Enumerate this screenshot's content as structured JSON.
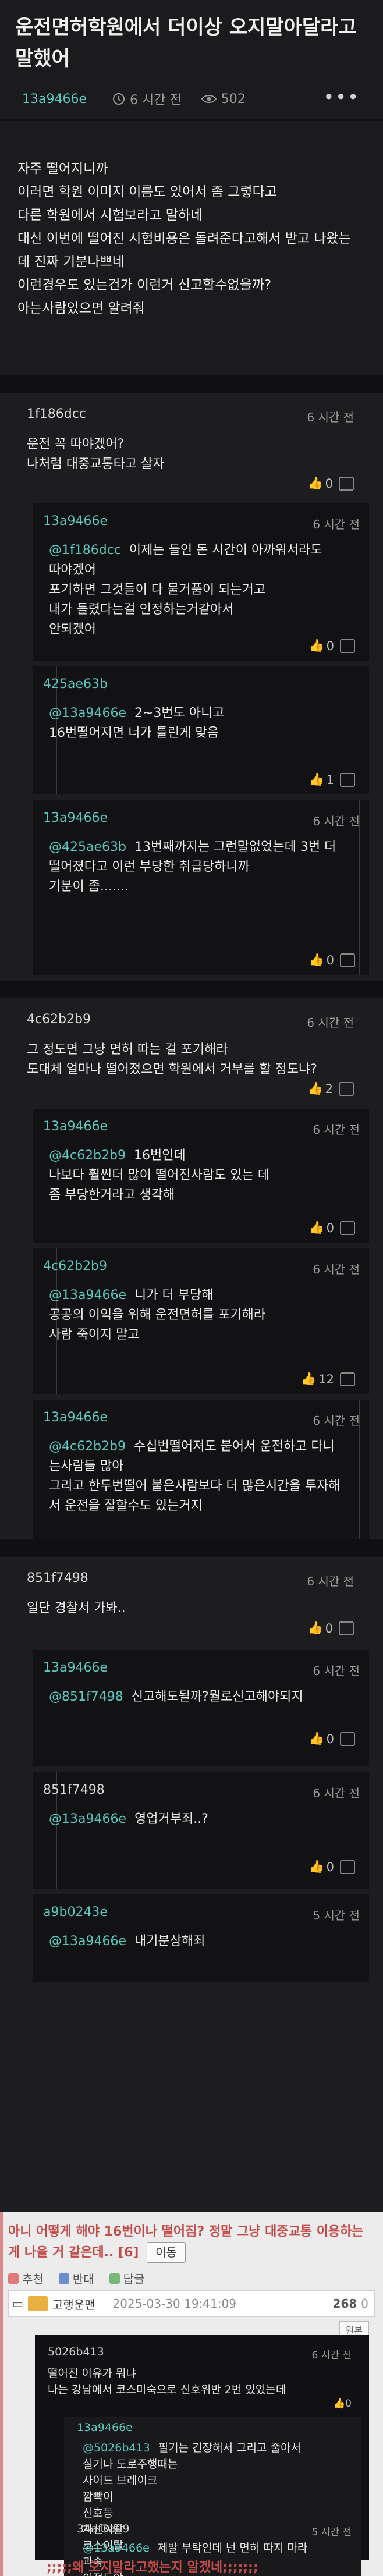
{
  "post": {
    "title": "운전면허학원에서 더이상 오지말아달라고 말했어",
    "author": "13a9466e",
    "time": "6 시간 전",
    "views": "502",
    "more": "•••",
    "body": [
      "자주 떨어지니까",
      "이러면 학원 이미지 이름도 있어서 좀 그렇다고",
      "다른 학원에서 시험보라고 말하네",
      "대신 이번에 떨어진 시험비용은 돌려준다고해서 받고 나왔는",
      "데 진짜 기분나쁘네",
      "이런경우도 있는건가 이런거 신고할수없을까?",
      "아는사람있으면 알려줘"
    ]
  },
  "threads": [
    {
      "author": "1f186dcc",
      "time": "6 시간 전",
      "lines": [
        "운전 꼭 따야겠어?",
        "나처럼 대중교통타고 살자"
      ],
      "likes": "0",
      "replies": [
        {
          "author": "13a9466e",
          "time": "6 시간 전",
          "mention": "@1f186dcc",
          "lines": [
            "이제는 들인 돈 시간이 아까워서라도",
            "따야겠어",
            "포기하면 그것들이 다 물거품이 되는거고",
            "내가 틀렸다는걸 인정하는거같아서",
            "안되겠어"
          ],
          "likes": "0"
        },
        {
          "author": "425ae63b",
          "time": "",
          "mention": "@13a9466e",
          "lines": [
            "2~3번도 아니고",
            "16번떨어지면 너가 틀린게 맞음"
          ],
          "likes": "1"
        },
        {
          "author": "13a9466e",
          "time": "6 시간 전",
          "mention": "@425ae63b",
          "lines": [
            "13번째까지는 그런말없었는데 3번 더",
            "떨어졌다고 이런 부당한 취급당하니까",
            "기분이 좀......."
          ],
          "likes": "0"
        }
      ]
    },
    {
      "author": "4c62b2b9",
      "time": "6 시간 전",
      "lines": [
        "그 정도면 그냥 면허 따는 걸 포기해라",
        "도대체 얼마나 떨어졌으면 학원에서 거부를 할 정도냐?"
      ],
      "likes": "2",
      "replies": [
        {
          "author": "13a9466e",
          "time": "6 시간 전",
          "mention": "@4c62b2b9",
          "lines": [
            "16번인데",
            "나보다 훨씬더 많이 떨어진사람도 있는 데",
            "좀 부당한거라고 생각해"
          ],
          "likes": "0"
        },
        {
          "author": "4c62b2b9",
          "time": "6 시간 전",
          "mention": "@13a9466e",
          "lines": [
            "니가 더 부당해",
            "공공의 이익을 위해 운전면허를 포기해라",
            "사람 죽이지 말고"
          ],
          "likes": "12"
        },
        {
          "author": "13a9466e",
          "time": "6 시간 전",
          "mention": "@4c62b2b9",
          "lines": [
            "수십번떨어져도 붙어서 운전하고 다니",
            "는사람들 많아",
            "그리고 한두번떨어 붙은사람보다 더 많은시간을 투자해",
            "서 운전을 잘할수도 있는거지"
          ],
          "likes": ""
        }
      ]
    },
    {
      "author": "851f7498",
      "time": "6 시간 전",
      "lines": [
        "일단 경찰서 가봐.."
      ],
      "likes": "0",
      "replies": [
        {
          "author": "13a9466e",
          "time": "6 시간 전",
          "mention": "@851f7498",
          "lines": [
            "신고해도될까?뭘로신고해야되지"
          ],
          "likes": "0"
        },
        {
          "author": "851f7498",
          "time": "6 시간 전",
          "mention": "@13a9466e",
          "lines": [
            "영업거부죄..?"
          ],
          "likes": "0"
        },
        {
          "author": "a9b0243e",
          "time": "5 시간 전",
          "mention": "@13a9466e",
          "lines": [
            "내기분상해죄"
          ],
          "likes": ""
        }
      ]
    }
  ],
  "repost": {
    "headline": "아니 어떻게 해야 16번이나 떨어짐? 정말 그냥 대중교통 이용하는게 나을 거 같은데.. [6]",
    "count": "[6]",
    "btn": "이동",
    "up": "추천",
    "down": "반대",
    "reply": "답글",
    "user": "고행운맨",
    "date": "2025-03-30 19:41:09",
    "num": "268",
    "num_zero": "0",
    "original_btn": "원본",
    "embed": [
      {
        "author": "5026b413",
        "time": "6 시간 전",
        "lines": [
          "떨어진 이유가 뭐냐",
          "나는 강남에서 코스미숙으로 신호위반 2번 있었는데"
        ],
        "likes": "0"
      },
      {
        "author": "13a9466e",
        "time": "",
        "mention": "@5026b413",
        "lines": [
          "필기는 긴장해서 그리고 줄아서",
          "실기나 도로주행때는",
          "사이드 브레이크",
          "깜빡이",
          "신호등",
          "차선이탈",
          "코스이탈",
          "과속",
          "이정도야"
        ],
        "likes": "0"
      },
      {
        "author": "34af3a09",
        "time": "5 시간 전",
        "mention": "@13a9466e",
        "lines": [
          "제발 부탁인데 넌 면허 따지 마라"
        ],
        "likes": "0"
      }
    ],
    "footer": ";;;;;왜 오지말라고했는지 알겠네;;;;;;;"
  },
  "icons": {
    "clock": "clock-icon",
    "eye": "eye-icon",
    "thumb": "thumb-up-icon",
    "dislike": "thumb-down-icon"
  }
}
